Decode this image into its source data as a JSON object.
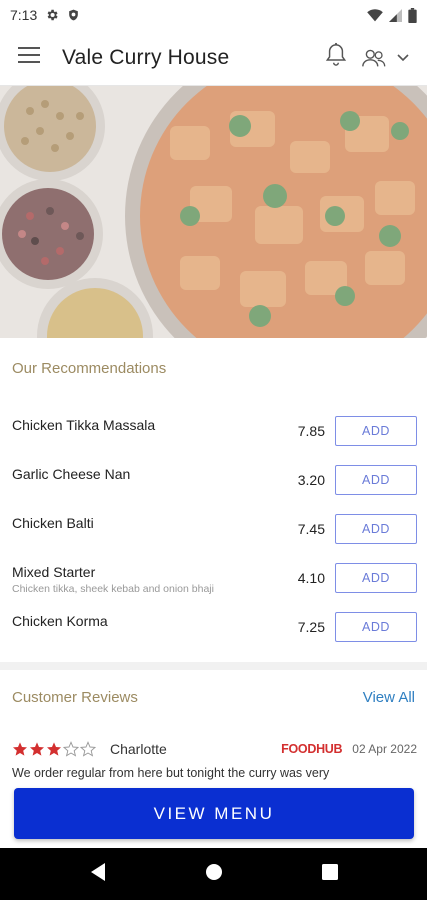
{
  "status_bar": {
    "time": "7:13",
    "icons": [
      "gear-icon",
      "shield-icon",
      "wifi-icon",
      "signal-icon",
      "battery-icon"
    ]
  },
  "app_bar": {
    "title": "Vale Curry House",
    "icons": [
      "menu-icon",
      "bell-icon",
      "users-icon",
      "chevron-down-icon"
    ]
  },
  "recommendations": {
    "title": "Our Recommendations",
    "add_label": "ADD",
    "items": [
      {
        "name": "Chicken Tikka Massala",
        "price": "7.85",
        "description": ""
      },
      {
        "name": "Garlic Cheese Nan",
        "price": "3.20",
        "description": ""
      },
      {
        "name": "Chicken Balti",
        "price": "7.45",
        "description": ""
      },
      {
        "name": "Mixed Starter",
        "price": "4.10",
        "description": "Chicken tikka, sheek kebab  and onion bhaji"
      },
      {
        "name": "Chicken Korma",
        "price": "7.25",
        "description": ""
      }
    ]
  },
  "reviews": {
    "title": "Customer Reviews",
    "view_all": "View All",
    "items": [
      {
        "rating": 3,
        "max_rating": 5,
        "reviewer": "Charlotte",
        "source": "FOODHUB",
        "date": "02 Apr 2022",
        "text": "We order regular from here but tonight the curry was very"
      }
    ]
  },
  "cta": {
    "label": "VIEW MENU"
  },
  "nav_bar": {
    "icons": [
      "back-icon",
      "home-icon",
      "recents-icon"
    ]
  },
  "colors": {
    "section_title": "#9c8b62",
    "add_border": "#7e8ee6",
    "link": "#2f7fc1",
    "brand_red": "#d32f2f",
    "star": "#d32f2f",
    "cta": "#0a2fd1"
  }
}
